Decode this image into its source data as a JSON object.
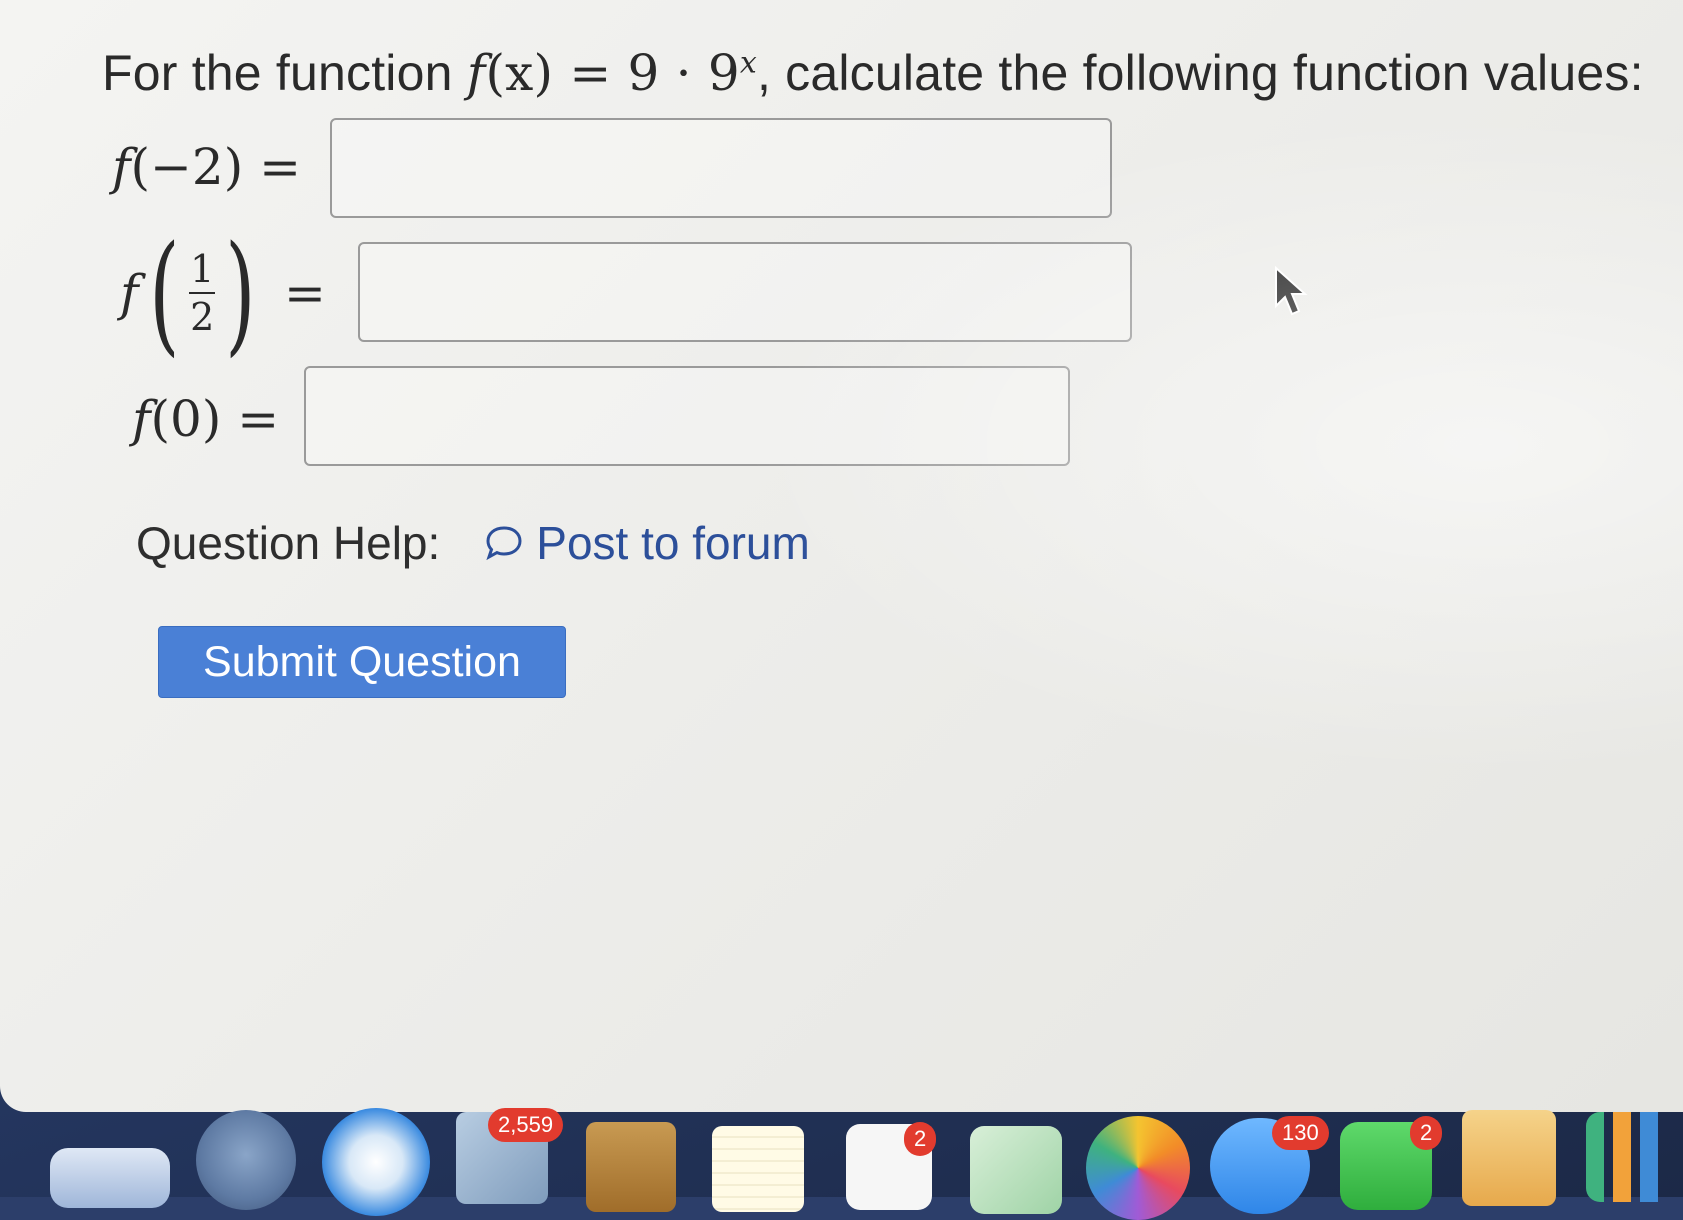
{
  "question": {
    "prefix": "For the function ",
    "func_name": "f",
    "func_arg": "(x)",
    "equals_expr": " = 9 · 9",
    "exponent": "x",
    "suffix": ", calculate the following function values:"
  },
  "answers": [
    {
      "label_func": "f",
      "label_arg": "(−2)",
      "equals": " =",
      "value": ""
    },
    {
      "label_func": "f",
      "frac_num": "1",
      "frac_den": "2",
      "equals": "=",
      "value": ""
    },
    {
      "label_func": "f",
      "label_arg": "(0)",
      "equals": " =",
      "value": ""
    }
  ],
  "help": {
    "label": "Question Help:",
    "forum_link": "Post to forum"
  },
  "submit_label": "Submit Question",
  "dock": {
    "badges": [
      "2,559",
      "2",
      "130",
      "2"
    ]
  },
  "colors": {
    "link": "#2c4f9a",
    "button": "#4a80d6",
    "badge": "#e23b2e"
  }
}
